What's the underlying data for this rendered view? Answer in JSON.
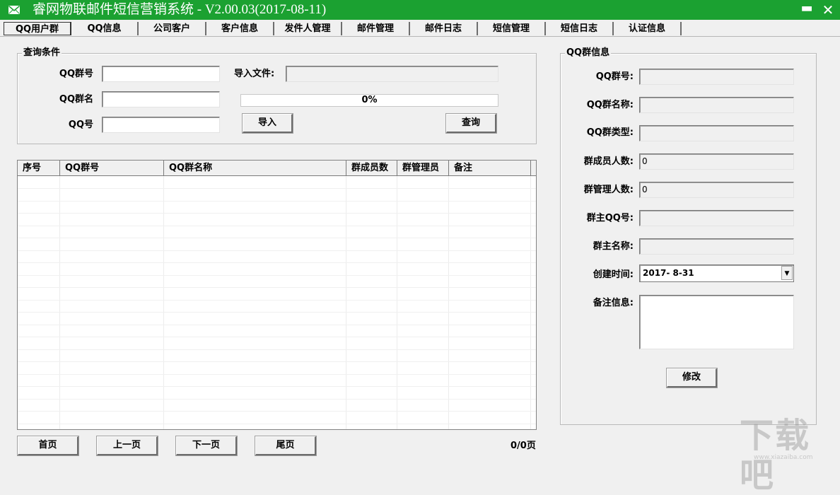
{
  "window": {
    "title": "睿网物联邮件短信营销系统 - V2.00.03(2017-08-11)",
    "icon": "mail-icon",
    "minimize_glyph": "▬",
    "close_glyph": "✕",
    "titlebar_color": "#1ba131"
  },
  "tabs": [
    {
      "label": "QQ用户群",
      "active": true
    },
    {
      "label": "QQ信息"
    },
    {
      "label": "公司客户"
    },
    {
      "label": "客户信息"
    },
    {
      "label": "发件人管理"
    },
    {
      "label": "邮件管理"
    },
    {
      "label": "邮件日志"
    },
    {
      "label": "短信管理"
    },
    {
      "label": "短信日志"
    },
    {
      "label": "认证信息"
    }
  ],
  "query": {
    "legend": "查询条件",
    "qq_group_no_label": "QQ群号",
    "qq_group_no_value": "",
    "qq_group_name_label": "QQ群名",
    "qq_group_name_value": "",
    "qq_no_label": "QQ号",
    "qq_no_value": "",
    "import_file_label": "导入文件:",
    "import_file_value": "",
    "progress_text": "0%",
    "progress_fraction": 0,
    "import_button": "导入",
    "query_button": "查询"
  },
  "grid": {
    "columns": [
      "序号",
      "QQ群号",
      "QQ群名称",
      "群成员数",
      "群管理员",
      "备注"
    ],
    "rows": []
  },
  "pager": {
    "first": "首页",
    "prev": "上一页",
    "next": "下一页",
    "last": "尾页",
    "status": "0/0页"
  },
  "group_info": {
    "legend": "QQ群信息",
    "group_no_label": "QQ群号:",
    "group_no_value": "",
    "group_name_label": "QQ群名称:",
    "group_name_value": "",
    "group_type_label": "QQ群类型:",
    "group_type_value": "",
    "member_count_label": "群成员人数:",
    "member_count_value": "0",
    "admin_count_label": "群管理人数:",
    "admin_count_value": "0",
    "owner_qq_label": "群主QQ号:",
    "owner_qq_value": "",
    "owner_name_label": "群主名称:",
    "owner_name_value": "",
    "create_time_label": "创建时间:",
    "create_time_value": "2017- 8-31",
    "remark_label": "备注信息:",
    "remark_value": "",
    "modify_button": "修改"
  },
  "watermark": {
    "text": "下载吧",
    "url": "www.xiazaiba.com"
  }
}
